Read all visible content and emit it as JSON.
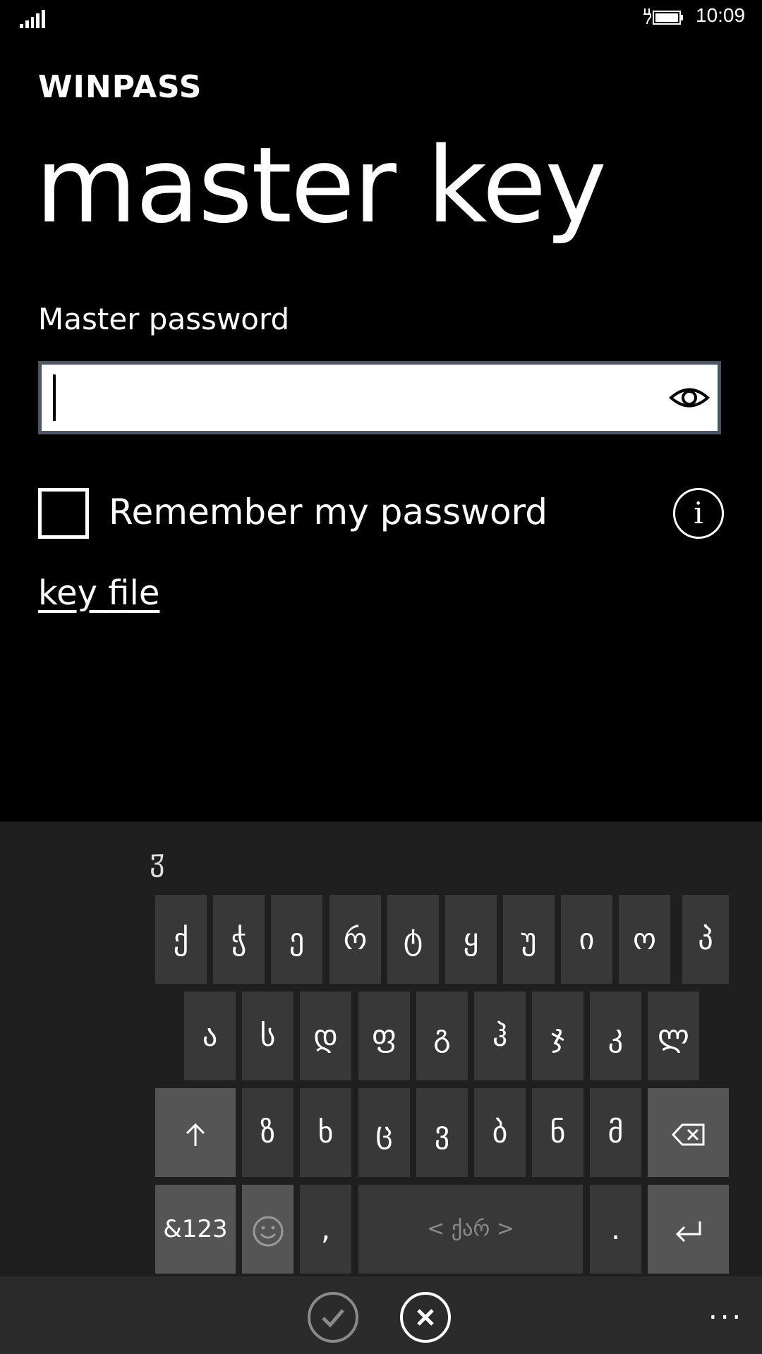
{
  "status_bar": {
    "time": "10:09",
    "signal_icon": "signal-bars-icon",
    "battery_icon": "battery-charging-icon"
  },
  "app": {
    "title": "WINPASS"
  },
  "page": {
    "title": "master key"
  },
  "form": {
    "password_label": "Master password",
    "password_value": "",
    "remember_label": "Remember my password",
    "remember_checked": false,
    "key_file_link": "key file"
  },
  "keyboard": {
    "suggestion": "ჳ",
    "row1": [
      "ქ",
      "ჭ",
      "ე",
      "რ",
      "ტ",
      "ყ",
      "უ",
      "ი",
      "ო",
      "პ"
    ],
    "row2": [
      "ა",
      "ს",
      "დ",
      "ფ",
      "გ",
      "ჰ",
      "ჯ",
      "კ",
      "ლ"
    ],
    "row3": [
      "ზ",
      "ხ",
      "ც",
      "ვ",
      "ბ",
      "ნ",
      "მ"
    ],
    "symbols_key": "&123",
    "comma_key": ",",
    "space_label": "< ქარ >",
    "period_key": ".",
    "shift_icon": "arrow-up-icon",
    "backspace_icon": "backspace-icon",
    "enter_icon": "enter-icon",
    "emoji_icon": "smiley-icon"
  },
  "app_bar": {
    "ok_icon": "checkmark-icon",
    "cancel_icon": "close-icon",
    "more_label": "..."
  }
}
